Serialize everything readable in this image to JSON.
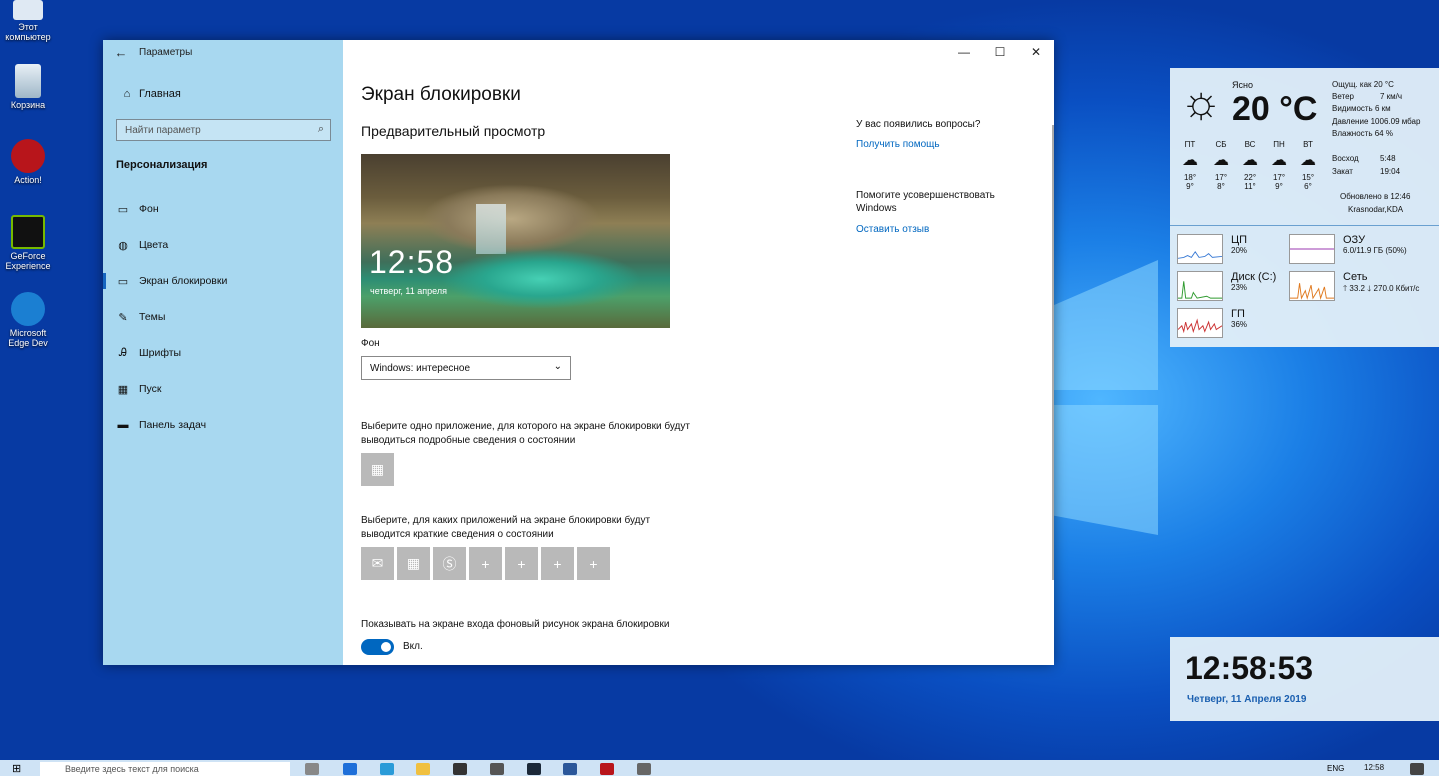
{
  "desktop": {
    "icons": [
      {
        "label": "Этот компьютер"
      },
      {
        "label": "Корзина"
      },
      {
        "label": "Action!"
      },
      {
        "label": "GeForce Experience"
      },
      {
        "label": "Microsoft Edge Dev"
      }
    ]
  },
  "window": {
    "title": "Параметры",
    "minimize": "—",
    "maximize": "☐",
    "close": "✕"
  },
  "sidebar": {
    "home": "Главная",
    "search_placeholder": "Найти параметр",
    "section": "Персонализация",
    "items": [
      {
        "label": "Фон"
      },
      {
        "label": "Цвета"
      },
      {
        "label": "Экран блокировки"
      },
      {
        "label": "Темы"
      },
      {
        "label": "Шрифты"
      },
      {
        "label": "Пуск"
      },
      {
        "label": "Панель задач"
      }
    ]
  },
  "main": {
    "title": "Экран блокировки",
    "preview_heading": "Предварительный просмотр",
    "preview_time": "12:58",
    "preview_date": "четверг, 11 апреля",
    "bg_label": "Фон",
    "bg_value": "Windows: интересное",
    "detail_label": "Выберите одно приложение, для которого на экране блокировки будут выводиться подробные сведения о состоянии",
    "quick_label": "Выберите, для каких приложений на экране блокировки будут выводится краткие сведения о состоянии",
    "signin_label": "Показывать на экране входа фоновый рисунок экрана блокировки",
    "toggle_state": "Вкл."
  },
  "help": {
    "question": "У вас появились вопросы?",
    "get_help": "Получить помощь",
    "improve": "Помогите усовершенствовать Windows",
    "feedback": "Оставить отзыв"
  },
  "weather": {
    "condition": "Ясно",
    "temp": "20 °C",
    "feels": "Ощущ. как 20 °C",
    "wind": "Ветер",
    "wind_v": "7 км/ч",
    "visibility": "Видимость 6 км",
    "pressure": "Давление  1006.09 мбар",
    "humidity": "Влажность  64 %",
    "forecast": [
      {
        "day": "ПТ",
        "hi": "18°",
        "lo": "9°"
      },
      {
        "day": "СБ",
        "hi": "17°",
        "lo": "8°"
      },
      {
        "day": "ВС",
        "hi": "22°",
        "lo": "11°"
      },
      {
        "day": "ПН",
        "hi": "17°",
        "lo": "9°"
      },
      {
        "day": "ВТ",
        "hi": "15°",
        "lo": "6°"
      }
    ],
    "sunrise": "Восход",
    "sunrise_v": "5:48",
    "sunset": "Закат",
    "sunset_v": "19:04",
    "updated": "Обновлено в 12:46",
    "location": "Krasnodar,KDA"
  },
  "monitor": {
    "cpu": "ЦП",
    "cpu_v": "20%",
    "ram": "ОЗУ",
    "ram_v": "6.0/11.9 ГБ (50%)",
    "disk": "Диск (C:)",
    "disk_v": "23%",
    "net": "Сеть",
    "net_v": "🡑 33.2 🡓 270.0 Кбит/с",
    "gpu": "ГП",
    "gpu_v": "36%"
  },
  "clock": {
    "time": "12:58:53",
    "date": "Четверг, 11 Апреля 2019"
  },
  "taskbar": {
    "search": "Введите здесь текст для поиска",
    "lang": "ENG",
    "time": "12:58"
  }
}
